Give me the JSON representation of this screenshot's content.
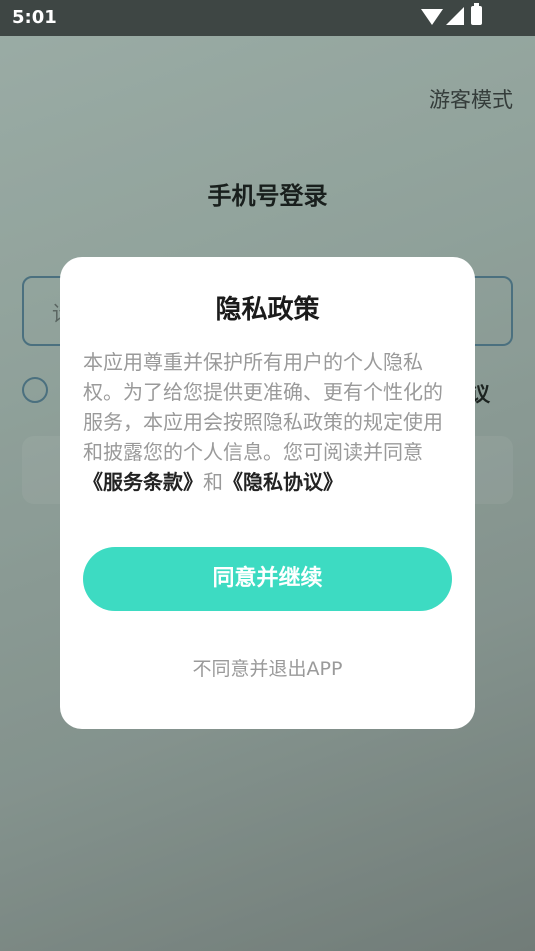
{
  "status_bar": {
    "time": "5:01",
    "icons": [
      "wifi-icon",
      "signal-icon",
      "battery-charging-icon"
    ]
  },
  "login_page": {
    "guest_mode": "游客模式",
    "title": "手机号登录",
    "phone_placeholder_partial": "请",
    "agreement_tail": "议"
  },
  "privacy_dialog": {
    "title": "隐私政策",
    "body_text": "本应用尊重并保护所有用户的个人隐私权。为了给您提供更准确、更有个性化的服务，本应用会按照隐私政策的规定使用和披露您的个人信息。您可阅读并同意",
    "terms_link": "《服务条款》",
    "conjunction": "和",
    "privacy_link": "《隐私协议》",
    "agree_button": "同意并继续",
    "decline_button": "不同意并退出APP"
  },
  "colors": {
    "accent": "#3ddbc2",
    "status_bar": "#3e4644",
    "input_border": "#5a8aa0"
  }
}
